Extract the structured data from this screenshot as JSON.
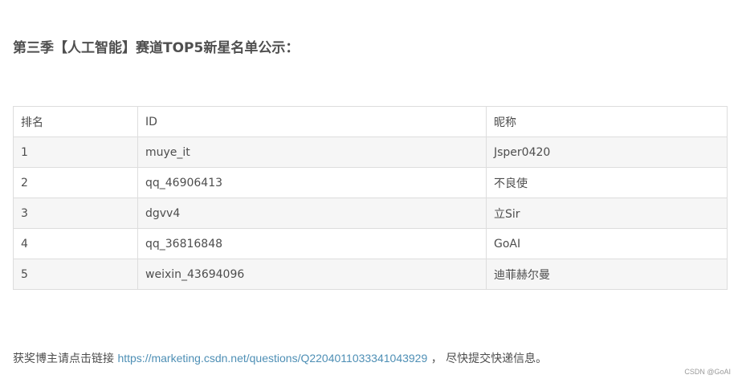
{
  "heading": "第三季【人工智能】赛道TOP5新星名单公示：",
  "table": {
    "headers": [
      "排名",
      "ID",
      "昵称"
    ],
    "rows": [
      [
        "1",
        "muye_it",
        "Jsper0420"
      ],
      [
        "2",
        "qq_46906413",
        "不良使"
      ],
      [
        "3",
        "dgvv4",
        "立Sir"
      ],
      [
        "4",
        "qq_36816848",
        "GoAI"
      ],
      [
        "5",
        "weixin_43694096",
        "迪菲赫尔曼"
      ]
    ]
  },
  "footer": {
    "prefix": "获奖博主请点击链接 ",
    "link_text": "https://marketing.csdn.net/questions/Q2204011033341043929",
    "suffix": " ， 尽快提交快递信息。"
  },
  "watermark": "CSDN @GoAI"
}
